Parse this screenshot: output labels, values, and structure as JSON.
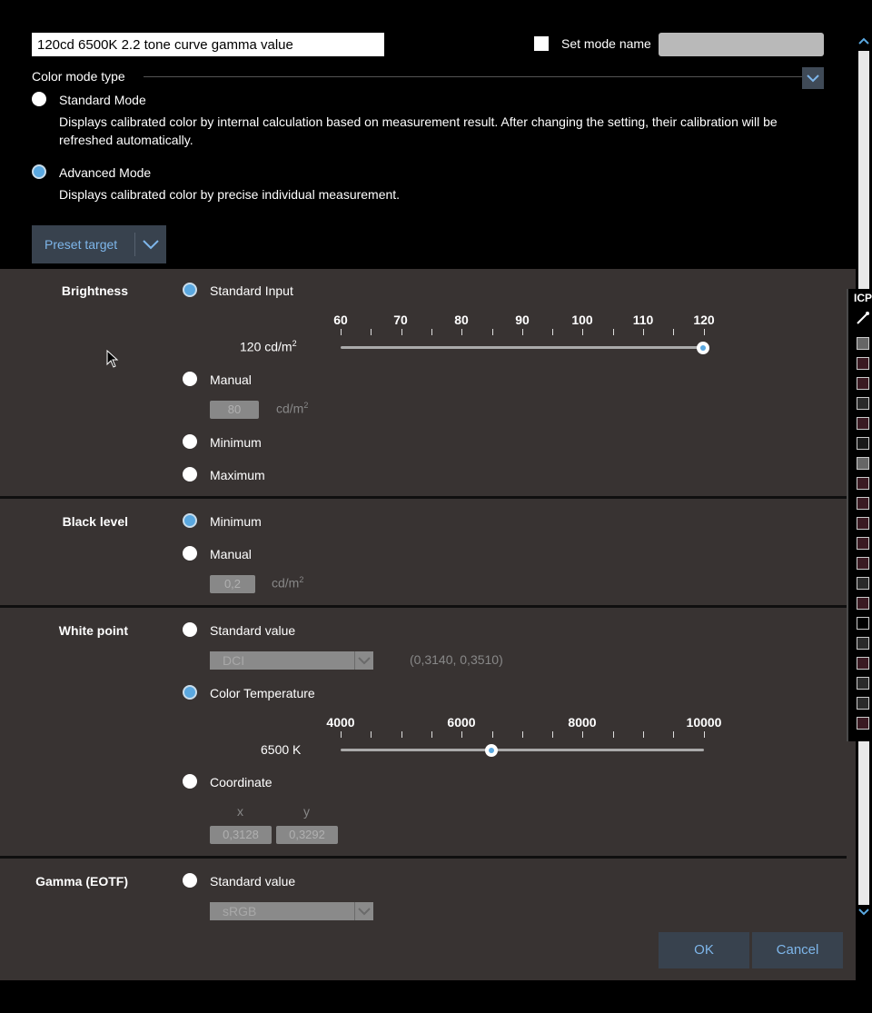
{
  "header": {
    "mode_value": "120cd 6500K 2.2 tone curve gamma value",
    "set_mode_name_label": "Set mode name",
    "color_mode_type_label": "Color mode type"
  },
  "modes": [
    {
      "label": "Standard Mode",
      "desc": "Displays calibrated color by internal calculation based on measurement result. After changing the setting, their calibration will be refreshed automatically.",
      "selected": false
    },
    {
      "label": "Advanced Mode",
      "desc": "Displays calibrated color by precise individual measurement.",
      "selected": true
    }
  ],
  "preset": {
    "label": "Preset target"
  },
  "brightness": {
    "label": "Brightness",
    "standard_input": "Standard Input",
    "ticks": [
      "60",
      "70",
      "80",
      "90",
      "100",
      "110",
      "120"
    ],
    "readout": "120 cd/m",
    "readout_sup": "2",
    "value": 120,
    "manual": "Manual",
    "manual_value": "80",
    "manual_unit": "cd/m",
    "manual_unit_sup": "2",
    "minimum": "Minimum",
    "maximum": "Maximum"
  },
  "black_level": {
    "label": "Black level",
    "minimum": "Minimum",
    "manual": "Manual",
    "manual_value": "0,2",
    "manual_unit": "cd/m",
    "manual_unit_sup": "2"
  },
  "white_point": {
    "label": "White point",
    "standard_value": "Standard value",
    "standard_select": "DCI",
    "standard_coords": "(0,3140, 0,3510)",
    "color_temperature": "Color Temperature",
    "ticks": [
      "4000",
      "6000",
      "8000",
      "10000"
    ],
    "readout": "6500 K",
    "value": 6500,
    "coordinate": "Coordinate",
    "x_label": "x",
    "y_label": "y",
    "x_value": "0,3128",
    "y_value": "0,3292"
  },
  "gamma": {
    "label": "Gamma (EOTF)",
    "standard_value": "Standard value",
    "standard_select": "sRGB"
  },
  "buttons": {
    "ok": "OK",
    "cancel": "Cancel"
  },
  "icp": {
    "title": "ICP"
  },
  "colors": {
    "accent": "#5aa8e0",
    "panel": "#383332",
    "button_bg": "#38424e",
    "button_text": "#7eb6ea"
  }
}
